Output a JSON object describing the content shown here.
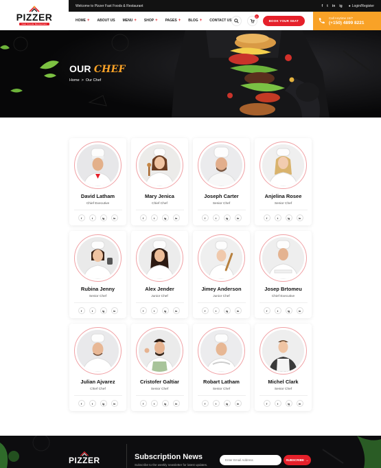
{
  "topbar": {
    "welcome": "Welcome to Pizzer Fast Foods & Restaurant",
    "socials": [
      "f",
      "t",
      "in",
      "ig"
    ],
    "login": "Login/Register"
  },
  "logo": {
    "name": "PIZZER",
    "tagline": "Fast Foods Restaurant"
  },
  "nav": {
    "items": [
      {
        "label": "HOME",
        "plus": "+"
      },
      {
        "label": "ABOUT US",
        "plus": ""
      },
      {
        "label": "MENU",
        "plus": "+"
      },
      {
        "label": "SHOP",
        "plus": "+"
      },
      {
        "label": "PAGES",
        "plus": "+"
      },
      {
        "label": "BLOG",
        "plus": "+"
      },
      {
        "label": "CONTACT US",
        "plus": ""
      }
    ],
    "cart_count": "0",
    "book_label": "BOOK YOUR SEAT"
  },
  "call": {
    "label": "Call Anytime 24/7",
    "number": "(+150) 4899 8221"
  },
  "hero": {
    "title_main": "OUR",
    "title_accent": "CHEF",
    "breadcrumb_home": "Home",
    "breadcrumb_sep": ">",
    "breadcrumb_current": "Our Chef"
  },
  "chefs": [
    {
      "name": "David Latham",
      "role": "Chief Executive"
    },
    {
      "name": "Mary Jenica",
      "role": "Chief Chef"
    },
    {
      "name": "Joseph Carter",
      "role": "Senior Chef"
    },
    {
      "name": "Anjelina Rosee",
      "role": "Senior Chef"
    },
    {
      "name": "Rubina Jenny",
      "role": "Senior Chef"
    },
    {
      "name": "Alex Jender",
      "role": "Junior Chef"
    },
    {
      "name": "Jimey Anderson",
      "role": "Junior Chef"
    },
    {
      "name": "Josep Brtomeu",
      "role": "Chief Executive"
    },
    {
      "name": "Julian Ajvarez",
      "role": "Chief Chef"
    },
    {
      "name": "Cristofer Galtiar",
      "role": "Senior Chef"
    },
    {
      "name": "Robart Latham",
      "role": "Senior Chef"
    },
    {
      "name": "Michel Clark",
      "role": "Senior Chef"
    }
  ],
  "chef_socials": [
    "f",
    "t",
    "ig",
    "in"
  ],
  "footer": {
    "logo_name": "PIZZER",
    "subscribe_title": "Subscription News",
    "subscribe_text": "Subscribe to the weekly newsletter for latest updates.",
    "email_placeholder": "Enter Email Address",
    "subscribe_button": "SUBSCRIBE"
  },
  "colors": {
    "accent_red": "#e5202a",
    "accent_orange": "#f9a227",
    "dark": "#121212"
  }
}
